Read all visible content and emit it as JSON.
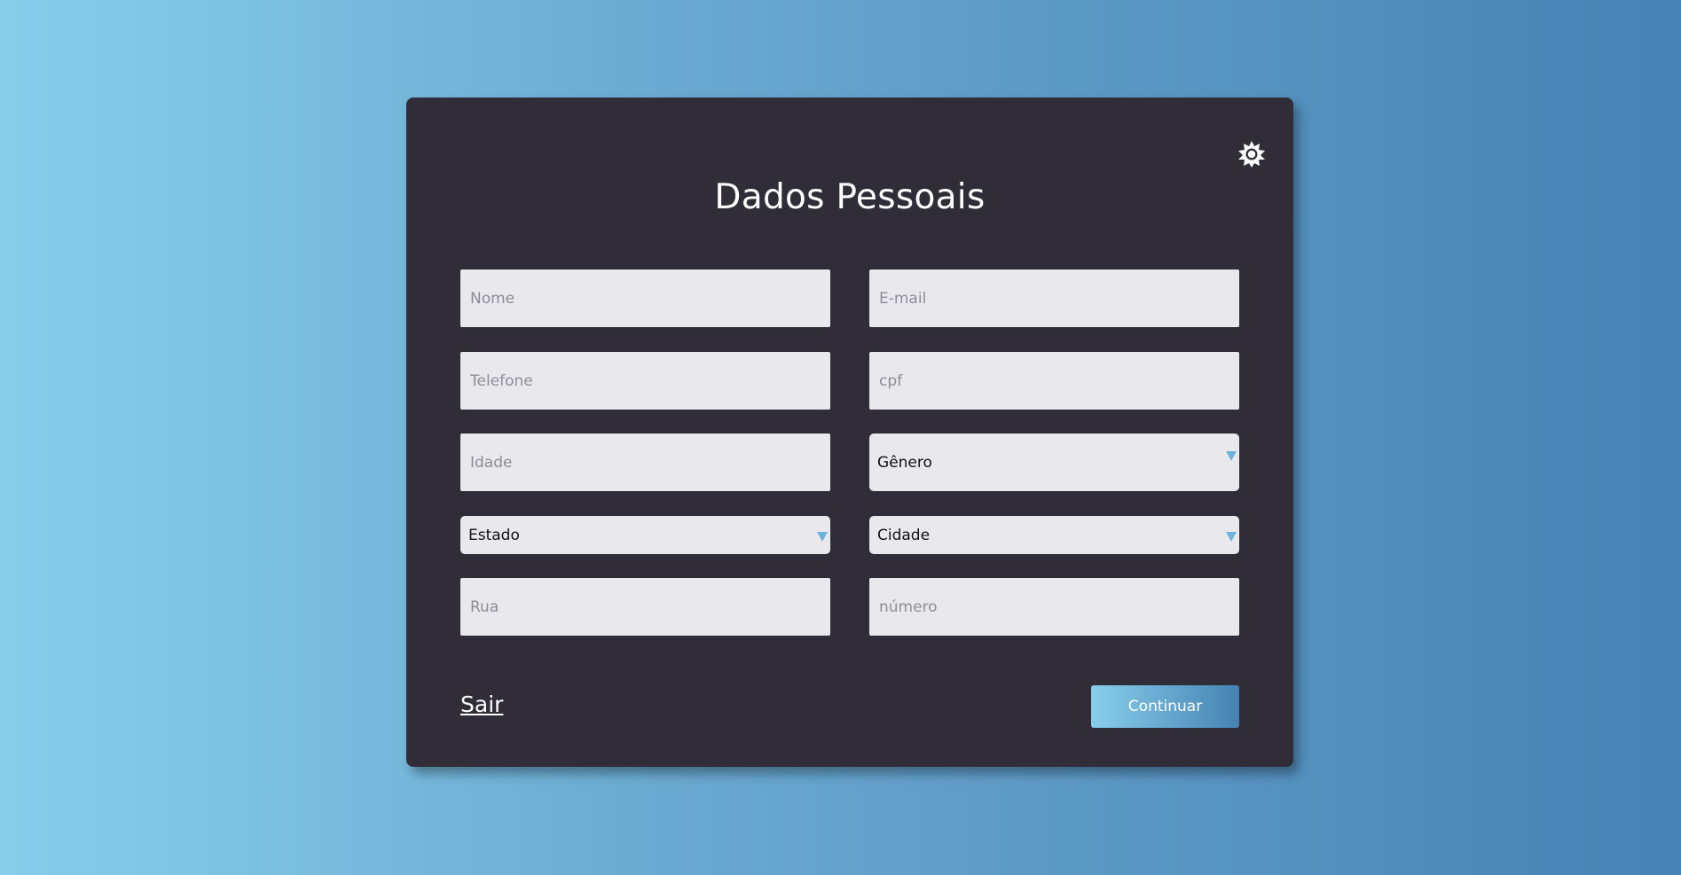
{
  "form": {
    "title": "Dados Pessoais",
    "fields": {
      "nome": {
        "placeholder": "Nome",
        "value": ""
      },
      "email": {
        "placeholder": "E-mail",
        "value": ""
      },
      "telefone": {
        "placeholder": "Telefone",
        "value": ""
      },
      "cpf": {
        "placeholder": "cpf",
        "value": ""
      },
      "idade": {
        "placeholder": "Idade",
        "value": ""
      },
      "rua": {
        "placeholder": "Rua",
        "value": ""
      },
      "numero": {
        "placeholder": "número",
        "value": ""
      }
    },
    "selects": {
      "genero": {
        "selected": "Gênero"
      },
      "estado": {
        "selected": "Estado"
      },
      "cidade": {
        "selected": "Cidade"
      }
    },
    "exit_label": "Sair",
    "continue_label": "Continuar"
  },
  "icons": {
    "theme_toggle": "sun-icon"
  },
  "colors": {
    "card_bg": "#302d38",
    "field_bg": "#e9e8ed",
    "accent_light": "#87ceeb",
    "accent_dark": "#4682b4",
    "select_arrow": "#6ab4dc"
  }
}
